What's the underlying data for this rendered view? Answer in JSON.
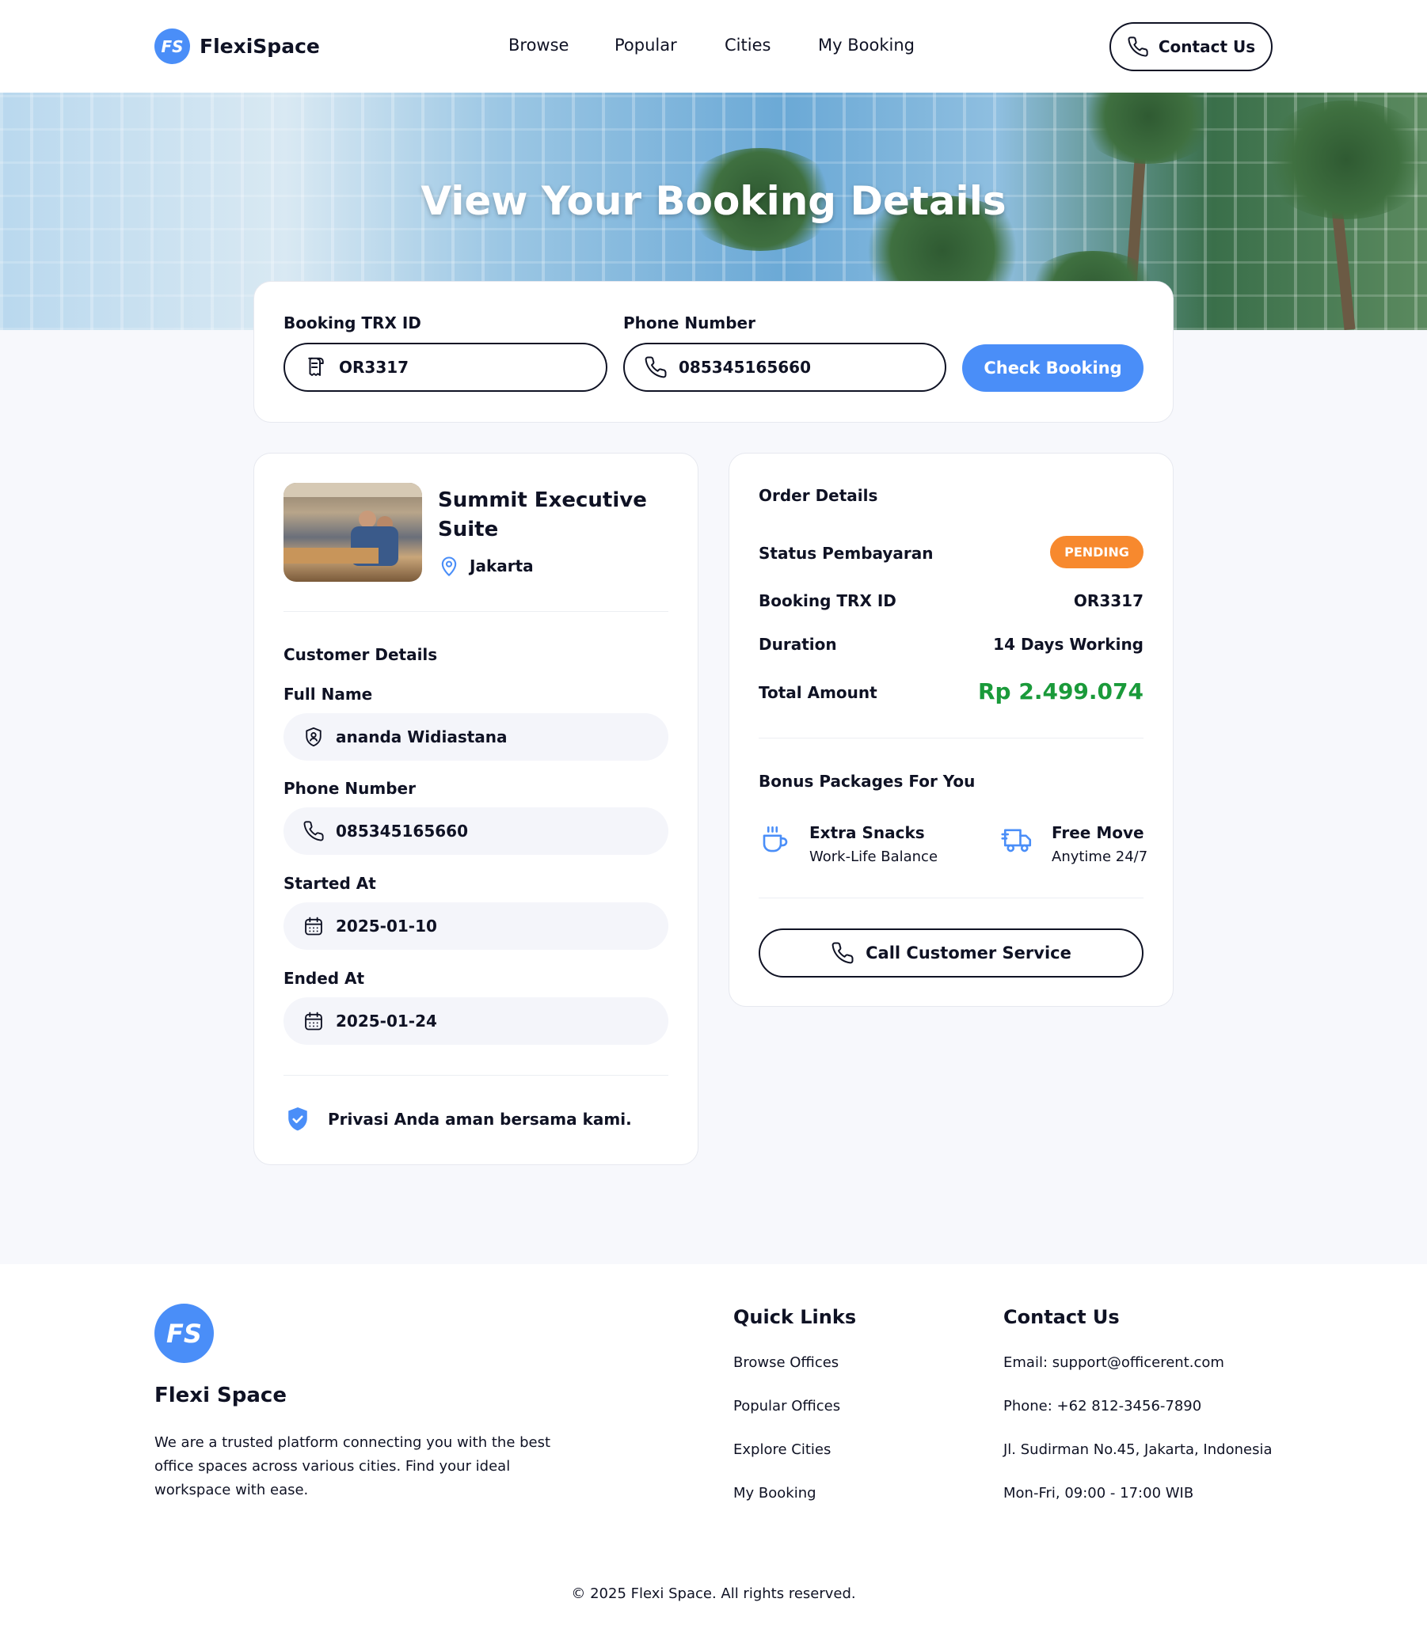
{
  "brand": {
    "name": "FlexiSpace",
    "logo_text": "FS"
  },
  "nav": {
    "items": [
      "Browse",
      "Popular",
      "Cities",
      "My Booking"
    ]
  },
  "header": {
    "contact_label": "Contact Us"
  },
  "hero": {
    "title": "View Your Booking Details"
  },
  "search": {
    "trx_label": "Booking TRX ID",
    "trx_value": "OR3317",
    "phone_label": "Phone Number",
    "phone_value": "085345165660",
    "button_label": "Check Booking"
  },
  "office": {
    "name": "Summit Executive Suite",
    "city": "Jakarta"
  },
  "customer": {
    "title": "Customer Details",
    "full_name_label": "Full Name",
    "full_name": "ananda Widiastana",
    "phone_label": "Phone Number",
    "phone": "085345165660",
    "started_label": "Started At",
    "started": "2025-01-10",
    "ended_label": "Ended At",
    "ended": "2025-01-24",
    "privacy": "Privasi Anda aman bersama kami."
  },
  "order": {
    "title": "Order Details",
    "status_label": "Status Pembayaran",
    "status": "PENDING",
    "trx_label": "Booking TRX ID",
    "trx_value": "OR3317",
    "duration_label": "Duration",
    "duration_value": "14 Days Working",
    "total_label": "Total Amount",
    "total_value": "Rp 2.499.074"
  },
  "bonus": {
    "title": "Bonus Packages For You",
    "items": [
      {
        "title": "Extra Snacks",
        "subtitle": "Work-Life Balance",
        "icon": "coffee-cup-icon"
      },
      {
        "title": "Free Move",
        "subtitle": "Anytime 24/7",
        "icon": "moving-truck-icon"
      }
    ],
    "cs_button": "Call Customer Service"
  },
  "footer": {
    "logo_text": "FS",
    "brand": "Flexi Space",
    "description": "We are a trusted platform connecting you with the best office spaces across various cities. Find your ideal workspace with ease.",
    "quick_links_title": "Quick Links",
    "quick_links": [
      "Browse Offices",
      "Popular Offices",
      "Explore Cities",
      "My Booking"
    ],
    "contact_title": "Contact Us",
    "contact": [
      "Email: support@officerent.com",
      "Phone: +62 812-3456-7890",
      "Jl. Sudirman No.45, Jakarta, Indonesia",
      "Mon-Fri, 09:00 - 17:00 WIB"
    ],
    "copyright": "© 2025 Flexi Space. All rights reserved."
  },
  "colors": {
    "accent": "#4a8ef8",
    "pending": "#f7892e",
    "total": "#1a9a3a",
    "text": "#0f1224"
  }
}
